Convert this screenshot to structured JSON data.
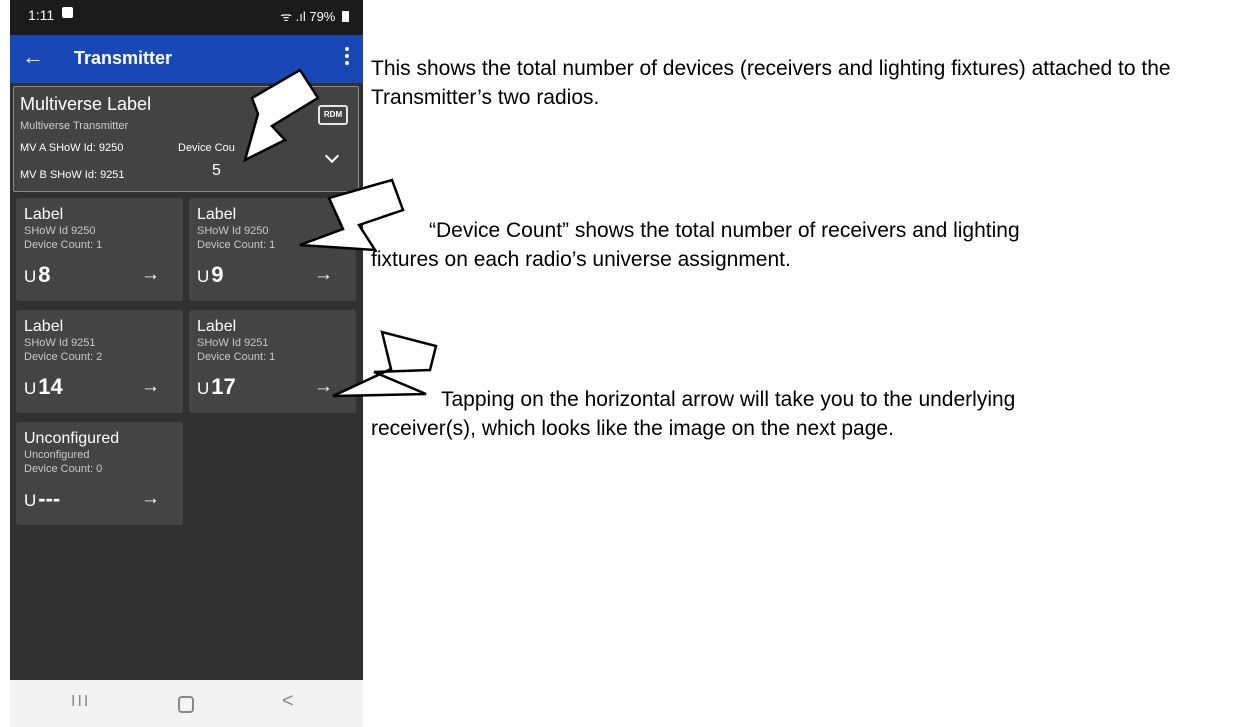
{
  "status_bar": {
    "time": "1:11",
    "signal": "ᯤ .ıl",
    "battery": "79%"
  },
  "app_bar": {
    "back_icon": "←",
    "title": "Transmitter",
    "menu_icon": "more-vert-icon"
  },
  "multiverse_card": {
    "title": "Multiverse Label",
    "subtitle": "Multiverse Transmitter",
    "mv_a": "MV A SHoW Id: 9250",
    "mv_b": "MV B SHoW Id: 9251",
    "device_count_label": "Device Cou",
    "device_count": "5",
    "rdm_badge": "RDM"
  },
  "tiles": [
    {
      "label": "Label",
      "show": "SHoW Id 9250",
      "device_count": "Device Count: 1",
      "u_prefix": "U",
      "universe": "8",
      "arrow": "→"
    },
    {
      "label": "Label",
      "show": "SHoW Id 9250",
      "device_count": "Device Count: 1",
      "u_prefix": "U",
      "universe": "9",
      "arrow": "→"
    },
    {
      "label": "Label",
      "show": "SHoW Id 9251",
      "device_count": "Device Count: 2",
      "u_prefix": "U",
      "universe": "14",
      "arrow": "→"
    },
    {
      "label": "Label",
      "show": "SHoW Id 9251",
      "device_count": "Device Count: 1",
      "u_prefix": "U",
      "universe": "17",
      "arrow": "→"
    },
    {
      "label": "Unconfigured",
      "show": "Unconfigured",
      "device_count": "Device Count: 0",
      "u_prefix": "U",
      "universe": "---",
      "arrow": "→"
    }
  ],
  "nav_bar": {
    "recent": "III",
    "back": "<"
  },
  "notes": {
    "p1": "This shows the total number of devices (receivers and lighting fixtures) attached to the Transmitter’s two radios.",
    "p2_line1": "“Device Count” shows the total number of receivers and lighting",
    "p2_line2": "fixtures on each radio’s universe assignment.",
    "p3_line1": "Tapping on the horizontal arrow will take you to the underlying",
    "p3_line2": "receiver(s), which looks like the image on the next page."
  }
}
